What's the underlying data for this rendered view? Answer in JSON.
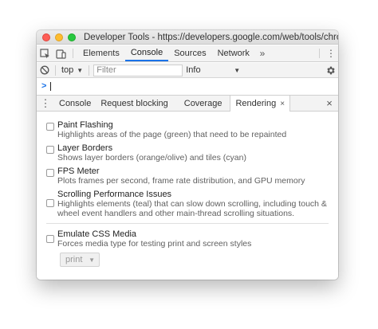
{
  "window": {
    "title": "Developer Tools - https://developers.google.com/web/tools/chrome-devtools/"
  },
  "tabbar": {
    "tabs": [
      {
        "label": "Elements",
        "active": false
      },
      {
        "label": "Console",
        "active": true
      },
      {
        "label": "Sources",
        "active": false
      },
      {
        "label": "Network",
        "active": false
      }
    ],
    "more": "»",
    "menu": "⋮"
  },
  "console_toolbar": {
    "context": "top",
    "filter_placeholder": "Filter",
    "levels": "Info"
  },
  "prompt": {
    "symbol": ">"
  },
  "drawer": {
    "menu": "⋮",
    "tabs": [
      {
        "label": "Console",
        "active": false
      },
      {
        "label": "Request blocking",
        "active": false
      },
      {
        "label": "Coverage",
        "active": false
      },
      {
        "label": "Rendering",
        "active": true
      }
    ],
    "tab_close": "×",
    "close": "×"
  },
  "rendering": {
    "options": [
      {
        "title": "Paint Flashing",
        "description": "Highlights areas of the page (green) that need to be repainted",
        "checked": false
      },
      {
        "title": "Layer Borders",
        "description": "Shows layer borders (orange/olive) and tiles (cyan)",
        "checked": false
      },
      {
        "title": "FPS Meter",
        "description": "Plots frames per second, frame rate distribution, and GPU memory",
        "checked": false
      },
      {
        "title": "Scrolling Performance Issues",
        "description": "Highlights elements (teal) that can slow down scrolling, including touch & wheel event handlers and other main-thread scrolling situations.",
        "checked": false
      },
      {
        "title": "Emulate CSS Media",
        "description": "Forces media type for testing print and screen styles",
        "checked": false
      }
    ],
    "media_type": "print"
  },
  "colors": {
    "accent": "#1a73e8",
    "traffic_red": "#fe5f57",
    "traffic_yellow": "#febc2e",
    "traffic_green": "#28c840"
  },
  "icons": {
    "inspect": "inspect-element-icon",
    "device": "device-toolbar-icon",
    "clear": "clear-console-icon",
    "settings": "gear-icon"
  }
}
